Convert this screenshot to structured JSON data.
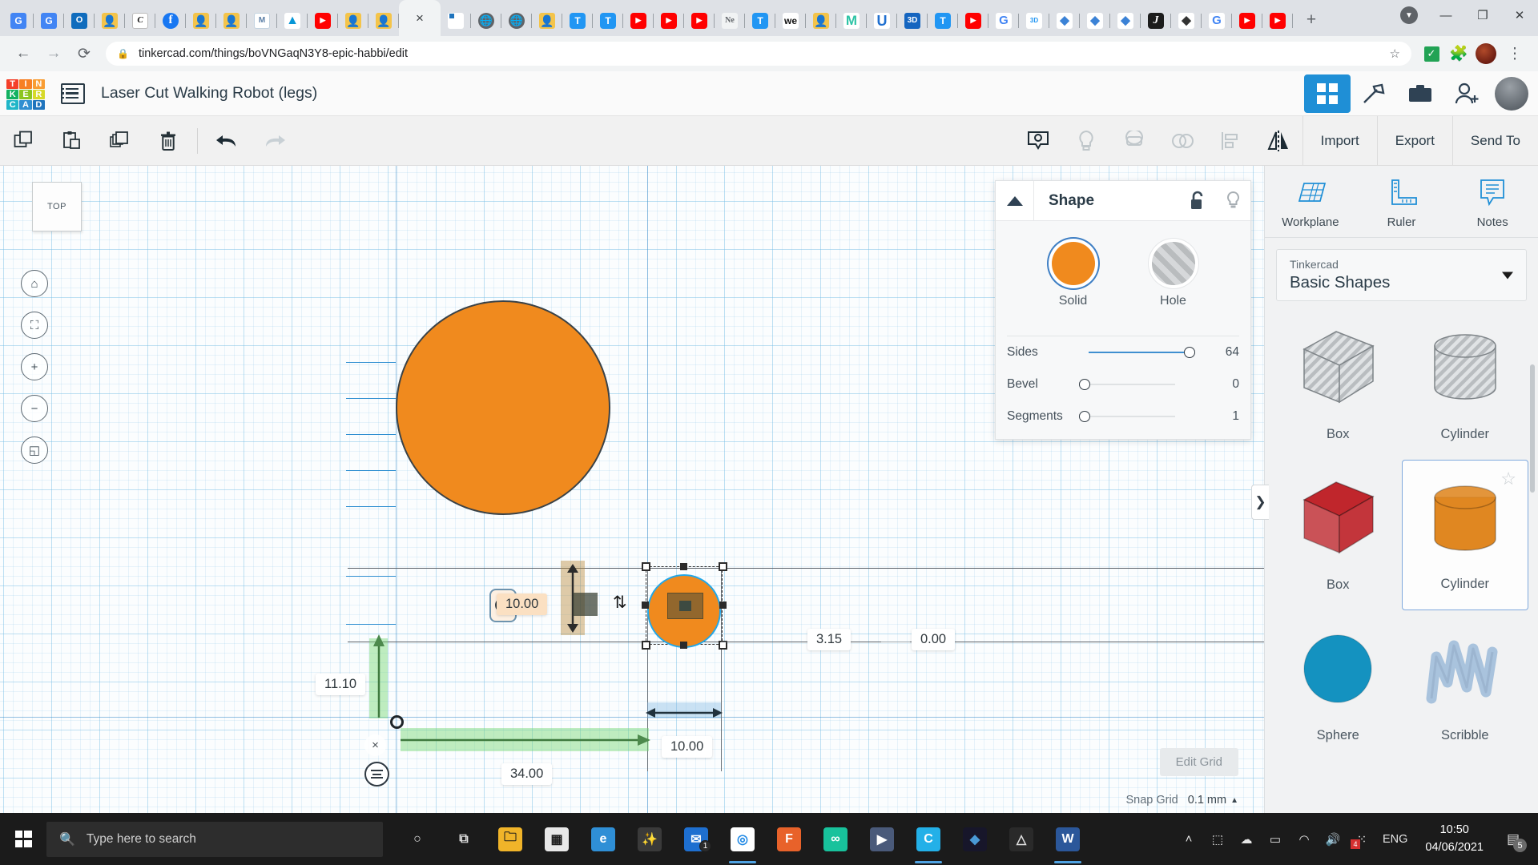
{
  "browser": {
    "tabs": [
      {
        "name": "google-translate-tab",
        "icon": "gtrans-icon",
        "glyph": "G",
        "cls": "fav-gtrans"
      },
      {
        "name": "google-translate-tab-2",
        "icon": "gtrans-icon",
        "glyph": "G",
        "cls": "fav-gtrans"
      },
      {
        "name": "outlook-tab",
        "icon": "outlook-icon",
        "glyph": "O",
        "cls": "fav-outlook"
      },
      {
        "name": "avatar-tab-1",
        "icon": "person-icon",
        "glyph": "👤",
        "cls": "fav-person"
      },
      {
        "name": "canva-tab",
        "icon": "c-icon",
        "glyph": "C",
        "cls": "fav-c"
      },
      {
        "name": "facebook-tab",
        "icon": "facebook-icon",
        "glyph": "f",
        "cls": "fav-fb"
      },
      {
        "name": "avatar-tab-2",
        "icon": "person-icon",
        "glyph": "👤",
        "cls": "fav-person"
      },
      {
        "name": "avatar-tab-3",
        "icon": "person-icon",
        "glyph": "👤",
        "cls": "fav-person"
      },
      {
        "name": "hex-m-tab",
        "icon": "hexagon-m-icon",
        "glyph": "M",
        "cls": "fav-m"
      },
      {
        "name": "autodesk-tab",
        "icon": "autodesk-icon",
        "glyph": "▲",
        "cls": "fav-autodesk"
      },
      {
        "name": "youtube-tab-1",
        "icon": "youtube-icon",
        "glyph": "▶",
        "cls": "fav-yt"
      },
      {
        "name": "avatar-tab-4",
        "icon": "person-icon",
        "glyph": "👤",
        "cls": "fav-person"
      },
      {
        "name": "avatar-tab-5",
        "icon": "person-icon",
        "glyph": "👤",
        "cls": "fav-person"
      }
    ],
    "active_tab": {
      "name": "tinkercad-active-tab",
      "close_label": "×"
    },
    "tabs_after": [
      {
        "name": "tinkercad-tab",
        "icon": "tinkercad-icon",
        "glyph": "",
        "cls": "fav-tink"
      },
      {
        "name": "globe-tab-1",
        "icon": "globe-icon",
        "glyph": "🌐",
        "cls": "fav-globe"
      },
      {
        "name": "globe-tab-2",
        "icon": "globe-icon",
        "glyph": "🌐",
        "cls": "fav-globe"
      },
      {
        "name": "avatar-tab-6",
        "icon": "person-icon",
        "glyph": "👤",
        "cls": "fav-person"
      },
      {
        "name": "tinkercad-tab-2",
        "icon": "tinkercad-t-icon",
        "glyph": "T",
        "cls": "fav-t"
      },
      {
        "name": "tinkercad-tab-3",
        "icon": "tinkercad-t-icon",
        "glyph": "T",
        "cls": "fav-t"
      },
      {
        "name": "youtube-tab-2",
        "icon": "youtube-icon",
        "glyph": "▶",
        "cls": "fav-yt"
      },
      {
        "name": "youtube-tab-3",
        "icon": "youtube-icon",
        "glyph": "▶",
        "cls": "fav-yt"
      },
      {
        "name": "youtube-tab-4",
        "icon": "youtube-icon",
        "glyph": "▶",
        "cls": "fav-yt"
      },
      {
        "name": "news-tab",
        "icon": "news-icon",
        "glyph": "Ne",
        "cls": "fav-ne"
      },
      {
        "name": "tinkercad-tab-4",
        "icon": "tinkercad-t-icon",
        "glyph": "T",
        "cls": "fav-t"
      },
      {
        "name": "wevideo-tab",
        "icon": "we-icon",
        "glyph": "we",
        "cls": "fav-we"
      },
      {
        "name": "avatar-tab-7",
        "icon": "person-icon",
        "glyph": "👤",
        "cls": "fav-person"
      },
      {
        "name": "mint-tab",
        "icon": "m-icon",
        "glyph": "M",
        "cls": "fav-mint"
      },
      {
        "name": "u-tab",
        "icon": "u-icon",
        "glyph": "U",
        "cls": "fav-u"
      },
      {
        "name": "3d-tab",
        "icon": "threed-icon",
        "glyph": "3D",
        "cls": "fav-3d"
      },
      {
        "name": "tinkercad-tab-5",
        "icon": "tinkercad-t-icon",
        "glyph": "T",
        "cls": "fav-t"
      },
      {
        "name": "youtube-tab-5",
        "icon": "youtube-icon",
        "glyph": "▶",
        "cls": "fav-yt"
      },
      {
        "name": "google-tab",
        "icon": "google-icon",
        "glyph": "G",
        "cls": "fav-g"
      },
      {
        "name": "3dwarehouse-tab",
        "icon": "warehouse-icon",
        "glyph": "3D",
        "cls": "fav-3dw"
      },
      {
        "name": "book-tab-1",
        "icon": "book-icon",
        "glyph": "◆",
        "cls": "fav-book"
      },
      {
        "name": "book-tab-2",
        "icon": "book-icon",
        "glyph": "◆",
        "cls": "fav-book"
      },
      {
        "name": "book-tab-3",
        "icon": "book-icon",
        "glyph": "◆",
        "cls": "fav-book"
      },
      {
        "name": "jupyter-tab",
        "icon": "j-icon",
        "glyph": "J",
        "cls": "fav-j"
      },
      {
        "name": "inkscape-tab",
        "icon": "inkscape-icon",
        "glyph": "◆",
        "cls": "fav-ink"
      },
      {
        "name": "google-tab-2",
        "icon": "google-icon",
        "glyph": "G",
        "cls": "fav-g"
      },
      {
        "name": "youtube-tab-6",
        "icon": "youtube-icon",
        "glyph": "▶",
        "cls": "fav-yt"
      },
      {
        "name": "youtube-tab-7",
        "icon": "youtube-icon",
        "glyph": "▶",
        "cls": "fav-yt"
      }
    ],
    "new_tab_label": "+",
    "window_controls": {
      "minimize": "—",
      "maximize": "❐",
      "close": "✕"
    },
    "url": "tinkercad.com/things/boVNGaqN3Y8-epic-habbi/edit",
    "back_label": "←",
    "forward_label": "→",
    "reload_label": "⟳",
    "lock_label": "🔒",
    "star_label": "☆",
    "menu_label": "⋮"
  },
  "tinkercad_header": {
    "logo_tiles": [
      {
        "letter": "T",
        "color": "#f4402a"
      },
      {
        "letter": "I",
        "color": "#f78023"
      },
      {
        "letter": "N",
        "color": "#f99d33"
      },
      {
        "letter": "K",
        "color": "#13b161"
      },
      {
        "letter": "E",
        "color": "#8cc520"
      },
      {
        "letter": "R",
        "color": "#d7d92a"
      },
      {
        "letter": "C",
        "color": "#20b6c8"
      },
      {
        "letter": "A",
        "color": "#2f8fd1"
      },
      {
        "letter": "D",
        "color": "#1f74bd"
      }
    ],
    "project_title": "Laser Cut Walking Robot (legs)",
    "right_icons": [
      {
        "name": "design-view-button",
        "glyph": "▦",
        "selected": true
      },
      {
        "name": "blocks-view-button",
        "glyph": "⛏",
        "selected": false
      },
      {
        "name": "gallery-button",
        "glyph": "▬",
        "selected": false
      },
      {
        "name": "invite-person-button",
        "glyph": "👤",
        "selected": false
      }
    ]
  },
  "toolbar": {
    "left_buttons": [
      {
        "name": "copy-button",
        "glyph": "copy"
      },
      {
        "name": "paste-button",
        "glyph": "paste"
      },
      {
        "name": "duplicate-button",
        "glyph": "duplicate"
      },
      {
        "name": "delete-button",
        "glyph": "trash"
      },
      {
        "name": "undo-button",
        "glyph": "undo"
      },
      {
        "name": "redo-button",
        "glyph": "redo"
      }
    ],
    "right_icons": [
      {
        "name": "show-hide-button",
        "glyph": "eye"
      },
      {
        "name": "light-bulb-button",
        "glyph": "bulb"
      },
      {
        "name": "group-button",
        "glyph": "group"
      },
      {
        "name": "ungroup-button",
        "glyph": "ungroup"
      },
      {
        "name": "align-button",
        "glyph": "align"
      },
      {
        "name": "mirror-button",
        "glyph": "mirror"
      }
    ],
    "actions": [
      {
        "name": "import-button",
        "label": "Import"
      },
      {
        "name": "export-button",
        "label": "Export"
      },
      {
        "name": "send-to-button",
        "label": "Send To"
      }
    ]
  },
  "canvas": {
    "view_cube_label": "TOP",
    "nav_controls": [
      {
        "name": "home-view-button",
        "glyph": "⌂"
      },
      {
        "name": "fit-view-button",
        "glyph": "⛶"
      },
      {
        "name": "zoom-in-button",
        "glyph": "+"
      },
      {
        "name": "zoom-out-button",
        "glyph": "−"
      },
      {
        "name": "ortho-perspective-button",
        "glyph": "◱"
      }
    ],
    "measurements": [
      {
        "name": "height-measurement-label",
        "value": "10.00",
        "highlight": true
      },
      {
        "name": "y-offset-measurement-label",
        "value": "11.10",
        "highlight": false
      },
      {
        "name": "x-offset-measurement-label",
        "value": "34.00",
        "highlight": false
      },
      {
        "name": "width-measurement-label",
        "value": "10.00",
        "highlight": false
      },
      {
        "name": "z-measurement-label",
        "value": "3.15",
        "highlight": false
      },
      {
        "name": "rotation-measurement-label",
        "value": "0.00",
        "highlight": false
      }
    ],
    "edit_grid_label": "Edit Grid",
    "snap_grid_label": "Snap Grid",
    "snap_grid_value": "0.1 mm",
    "panel_expand_label": "❯"
  },
  "shape_panel": {
    "title": "Shape",
    "lock_icon": "unlock-icon",
    "bulb_icon": "bulb-icon",
    "modes": [
      {
        "name": "solid-mode-button",
        "label": "Solid",
        "selected": true,
        "color": "#f08a1e"
      },
      {
        "name": "hole-mode-button",
        "label": "Hole",
        "selected": false,
        "color": "#b9bcbe"
      }
    ],
    "properties": [
      {
        "name": "sides-slider",
        "label": "Sides",
        "value": "64",
        "percent": 86
      },
      {
        "name": "bevel-slider",
        "label": "Bevel",
        "value": "0",
        "percent": 0
      },
      {
        "name": "segments-slider",
        "label": "Segments",
        "value": "1",
        "percent": 0
      }
    ]
  },
  "sidebar": {
    "tools": [
      {
        "name": "workplane-tool",
        "label": "Workplane",
        "icon": "workplane-icon"
      },
      {
        "name": "ruler-tool",
        "label": "Ruler",
        "icon": "ruler-icon"
      },
      {
        "name": "notes-tool",
        "label": "Notes",
        "icon": "notes-icon"
      }
    ],
    "library_select": {
      "name": "shape-library-select",
      "sub_label": "Tinkercad",
      "main_label": "Basic Shapes"
    },
    "shapes": [
      {
        "name": "shape-box-hole",
        "label": "Box",
        "kind": "box",
        "color": "hatch",
        "selected": false,
        "star": false
      },
      {
        "name": "shape-cylinder-hole",
        "label": "Cylinder",
        "kind": "cylinder",
        "color": "hatch",
        "selected": false,
        "star": false
      },
      {
        "name": "shape-box-solid",
        "label": "Box",
        "kind": "box",
        "color": "#c0262c",
        "selected": false,
        "star": false
      },
      {
        "name": "shape-cylinder-solid",
        "label": "Cylinder",
        "kind": "cylinder",
        "color": "#e08721",
        "selected": true,
        "star": true
      },
      {
        "name": "shape-sphere",
        "label": "Sphere",
        "kind": "sphere",
        "color": "#1492c0",
        "selected": false,
        "star": false
      },
      {
        "name": "shape-scribble",
        "label": "Scribble",
        "kind": "scribble",
        "color": "#a9c3dd",
        "selected": false,
        "star": false
      }
    ]
  },
  "taskbar": {
    "search_placeholder": "Type here to search",
    "search_icon": "magnifier-icon",
    "buttons": [
      {
        "name": "cortana-button",
        "glyph": "○",
        "color": "transparent",
        "text": "#e0e0e0",
        "running": false
      },
      {
        "name": "task-view-button",
        "glyph": "⧉",
        "color": "transparent",
        "text": "#e0e0e0",
        "running": false
      },
      {
        "name": "file-explorer-button",
        "glyph": "🗀",
        "color": "#f0b429",
        "text": "#1b1b1b",
        "running": false
      },
      {
        "name": "microsoft-store-button",
        "glyph": "▦",
        "color": "#e8e8e8",
        "text": "#1b1b1b",
        "running": false
      },
      {
        "name": "edge-button",
        "glyph": "e",
        "color": "#2f8fd6",
        "text": "#ffffff",
        "running": false
      },
      {
        "name": "blender-button",
        "glyph": "✨",
        "color": "#3a3a3a",
        "text": "#e87d0d",
        "running": false
      },
      {
        "name": "mail-button",
        "glyph": "✉",
        "color": "#1e6fd0",
        "text": "#ffffff",
        "running": false,
        "badge": "1"
      },
      {
        "name": "chrome-button",
        "glyph": "◎",
        "color": "#ffffff",
        "text": "#1e88e5",
        "running": true
      },
      {
        "name": "figma-button",
        "glyph": "F",
        "color": "#e8622a",
        "text": "#ffffff",
        "running": false
      },
      {
        "name": "infinity-button",
        "glyph": "∞",
        "color": "#18c29c",
        "text": "#ffffff",
        "running": false
      },
      {
        "name": "video-button",
        "glyph": "▶",
        "color": "#4a5a7a",
        "text": "#ffffff",
        "running": false
      },
      {
        "name": "canva-button",
        "glyph": "C",
        "color": "#23b0e8",
        "text": "#ffffff",
        "running": true
      },
      {
        "name": "affinity-button",
        "glyph": "◆",
        "color": "#17162a",
        "text": "#4a9ad6",
        "running": false
      },
      {
        "name": "autodesk-button",
        "glyph": "△",
        "color": "#2a2a2a",
        "text": "#e0e0e0",
        "running": false
      },
      {
        "name": "word-button",
        "glyph": "W",
        "color": "#2b579a",
        "text": "#ffffff",
        "running": true
      }
    ],
    "tray": [
      {
        "name": "show-hidden-icons-button",
        "glyph": "˄"
      },
      {
        "name": "screen-capture-icon",
        "glyph": "⬚"
      },
      {
        "name": "onedrive-icon",
        "glyph": "☁"
      },
      {
        "name": "battery-icon",
        "glyph": "▭"
      },
      {
        "name": "wifi-icon",
        "glyph": "◠"
      },
      {
        "name": "volume-icon",
        "glyph": "🔊"
      },
      {
        "name": "notification-tray-icon",
        "glyph": "⁙",
        "badge": "4"
      }
    ],
    "language": "ENG",
    "time": "10:50",
    "date": "04/06/2021",
    "notification_glyph": "▤",
    "notification_count": "5"
  }
}
